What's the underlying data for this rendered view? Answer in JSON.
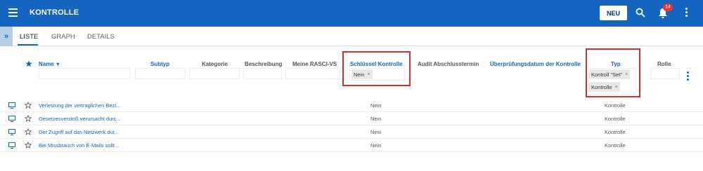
{
  "app": {
    "title": "KONTROLLE",
    "new_button": "NEU",
    "notification_count": "14"
  },
  "tabs": [
    {
      "label": "LISTE",
      "active": true
    },
    {
      "label": "GRAPH",
      "active": false
    },
    {
      "label": "DETAILS",
      "active": false
    }
  ],
  "columns": {
    "name": "Name",
    "subtyp": "Subtyp",
    "kategorie": "Kategorie",
    "beschreibung": "Beschreibung",
    "rasci": "Meine RASCI-VS",
    "schluessel": "Schlüssel Kontrolle",
    "audit": "Audit Abschlusstermin",
    "ueberpruefung": "Überprüfungsdatum der Kontrolle",
    "typ": "Typ",
    "rolle": "Rolle"
  },
  "filters": {
    "schluessel_chip": "Nein",
    "typ_chip_1": "Kontroll \"Set\"",
    "typ_chip_2": "Kontrolle",
    "chip_remove": "×"
  },
  "rows": [
    {
      "name": "Verletzung der vertraglichen Bezi...",
      "schluessel": "Nein",
      "typ": "Kontrolle"
    },
    {
      "name": "Gesetzesverstoß verursacht durc...",
      "schluessel": "Nein",
      "typ": "Kontrolle"
    },
    {
      "name": "Der Zugriff auf das Netzwerk dur...",
      "schluessel": "Nein",
      "typ": "Kontrolle"
    },
    {
      "name": "Bei Missbrauch von E-Mails sollt...",
      "schluessel": "Nein",
      "typ": "Kontrolle"
    }
  ],
  "colors": {
    "primary": "#1565c0",
    "highlight": "#d32f2f"
  },
  "icons": [
    "menu-icon",
    "search-icon",
    "bell-icon",
    "more-vert-icon",
    "collapse-icon",
    "star-icon",
    "monitor-icon",
    "sort-desc-icon"
  ]
}
